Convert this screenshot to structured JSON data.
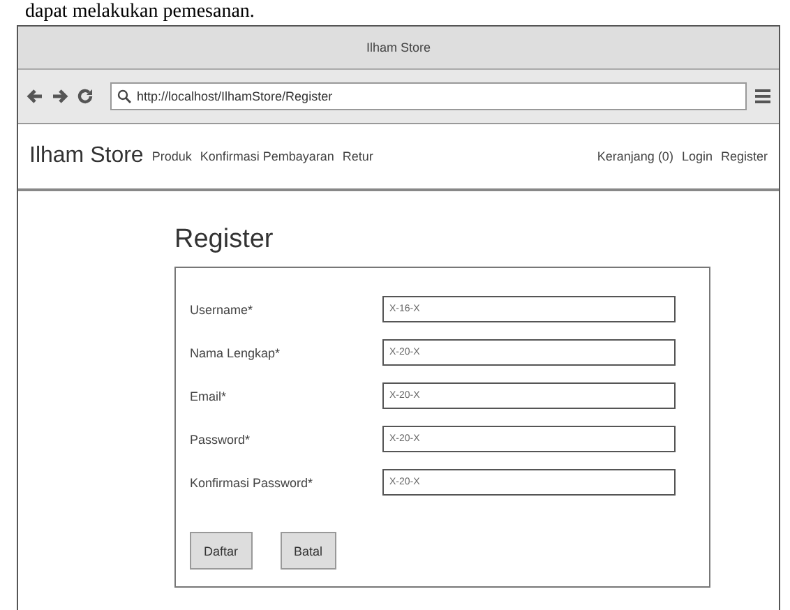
{
  "caption": "dapat melakukan pemesanan.",
  "window": {
    "title": "Ilham Store"
  },
  "address_bar": {
    "url": "http://localhost/IlhamStore/Register"
  },
  "navbar": {
    "brand": "Ilham Store",
    "left_links": [
      "Produk",
      "Konfirmasi Pembayaran",
      "Retur"
    ],
    "right_links": [
      "Keranjang (0)",
      "Login",
      "Register"
    ]
  },
  "heading": "Register",
  "form": {
    "fields": [
      {
        "label": "Username*",
        "value": "X-16-X"
      },
      {
        "label": "Nama Lengkap*",
        "value": "X-20-X"
      },
      {
        "label": "Email*",
        "value": "X-20-X"
      },
      {
        "label": "Password*",
        "value": "X-20-X"
      },
      {
        "label": "Konfirmasi Password*",
        "value": "X-20-X"
      }
    ],
    "buttons": [
      "Daftar",
      "Batal"
    ]
  }
}
